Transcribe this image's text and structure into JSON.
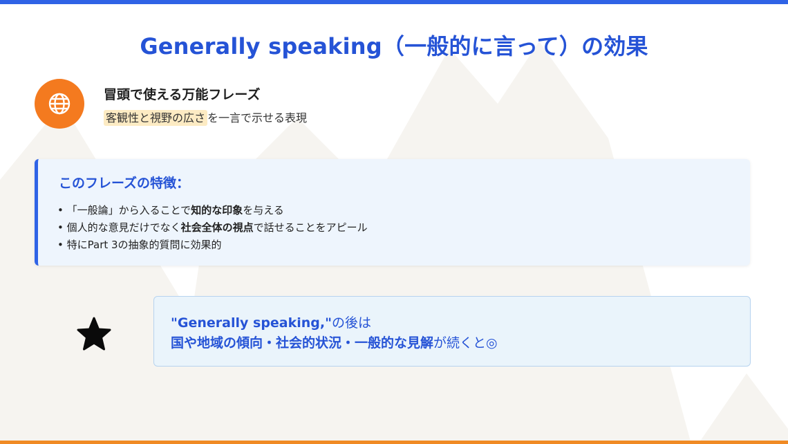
{
  "title": "Generally speaking（一般的に言って）の効果",
  "intro": {
    "icon": "globe-icon",
    "headline": "冒頭で使える万能フレーズ",
    "sub_highlight": "客観性と視野の広さ",
    "sub_rest": "を一言で示せる表現"
  },
  "features": {
    "title": "このフレーズの特徴：",
    "items": [
      {
        "pre": "「一般論」から入ることで",
        "bold": "知的な印象",
        "post": "を与える"
      },
      {
        "pre": "個人的な意見だけでなく",
        "bold": "社会全体の視点",
        "post": "で話せることをアピール"
      },
      {
        "pre": "特にPart 3の抽象的質問に効果的",
        "bold": "",
        "post": ""
      }
    ]
  },
  "note": {
    "icon": "star-icon",
    "phrase": "\"Generally speaking,\"",
    "after_phrase": "の後は",
    "bold_topics": "国や地域の傾向・社会的状況・一般的な見解",
    "ending": "が続くと◎"
  },
  "colors": {
    "accent_blue": "#2f63e6",
    "title_blue": "#2553d6",
    "accent_orange": "#f47a1f",
    "highlight": "#fdebc3"
  }
}
